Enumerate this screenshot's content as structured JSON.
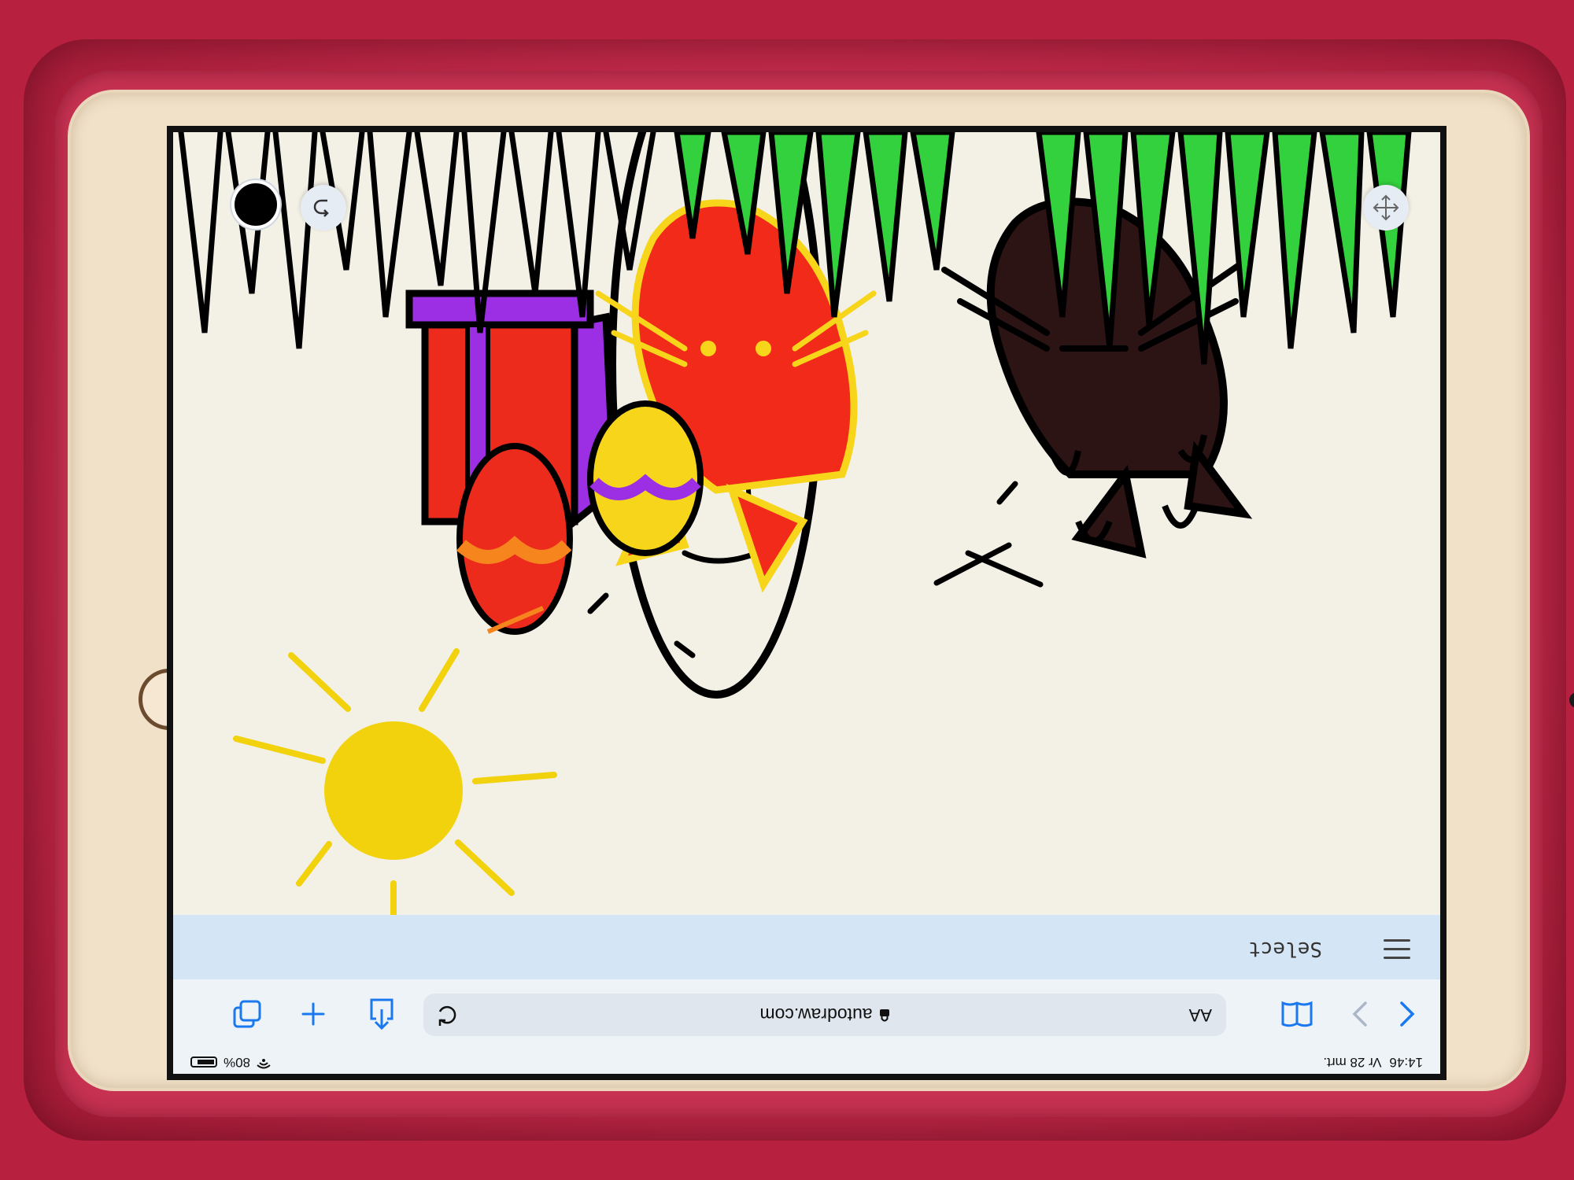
{
  "status_bar": {
    "time": "14:46",
    "date": "Vr 28 mrt.",
    "battery": "80%",
    "battery_level": 0.8
  },
  "safari": {
    "text_size_label": "AA",
    "url": "autodraw.com"
  },
  "app": {
    "select_label": "Select"
  },
  "canvas": {
    "selected_color": "#000000"
  },
  "icons": [
    "back-icon",
    "forward-icon",
    "bookmarks-icon",
    "reload-icon",
    "share-icon",
    "new-tab-icon",
    "tabs-icon",
    "menu-icon",
    "move-icon",
    "undo-icon",
    "lock-icon",
    "battery-icon",
    "wifi-icon"
  ]
}
